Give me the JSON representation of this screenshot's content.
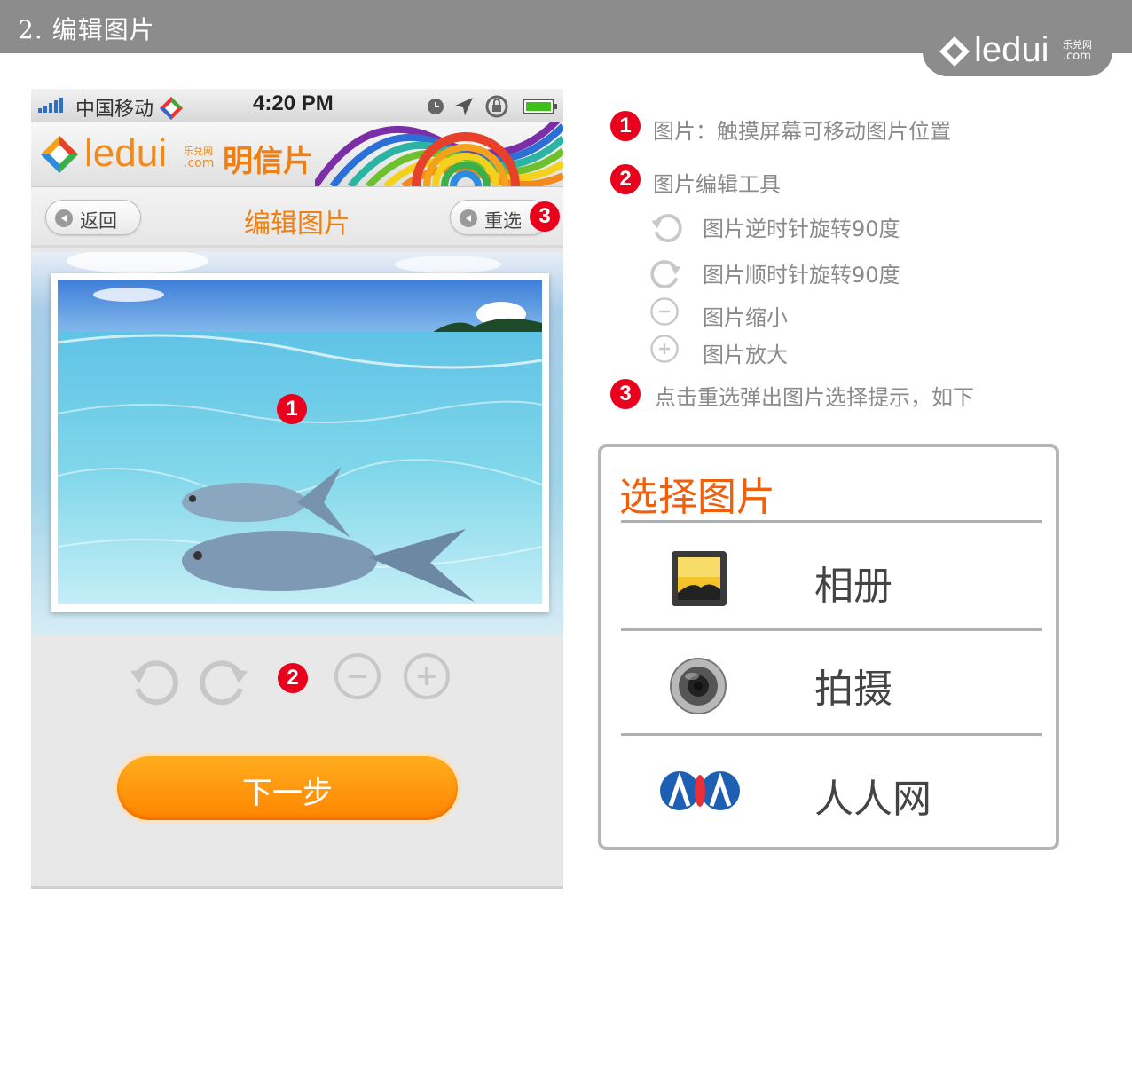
{
  "banner": {
    "title": "2. 编辑图片",
    "brand": "ledui",
    "brand_cn": "乐兑网",
    "brand_com": ".com"
  },
  "phone": {
    "status_bar": {
      "carrier": "中国移动",
      "time": "4:20 PM"
    },
    "app_header": {
      "brand": "ledui",
      "brand_cn": "乐兑网",
      "brand_com": ".com",
      "title": "明信片"
    },
    "nav": {
      "back_label": "返回",
      "title": "编辑图片",
      "reselect_label": "重选"
    },
    "next_button": "下一步"
  },
  "badges": {
    "one": "1",
    "two": "2",
    "three": "3"
  },
  "legend": {
    "item1": "图片：触摸屏幕可移动图片位置",
    "item2": "图片编辑工具",
    "tools": [
      {
        "icon": "rotate-ccw-icon",
        "label": "图片逆时针旋转90度"
      },
      {
        "icon": "rotate-cw-icon",
        "label": "图片顺时针旋转90度"
      },
      {
        "icon": "zoom-out-icon",
        "label": "图片缩小"
      },
      {
        "icon": "zoom-in-icon",
        "label": "图片放大"
      }
    ],
    "item3": "点击重选弹出图片选择提示，如下"
  },
  "dialog": {
    "title": "选择图片",
    "options": [
      {
        "icon": "album-icon",
        "label": "相册"
      },
      {
        "icon": "camera-icon",
        "label": "拍摄"
      },
      {
        "icon": "renren-icon",
        "label": "人人网"
      }
    ]
  },
  "colors": {
    "accent_orange": "#ee7f10",
    "badge_red": "#e8001c",
    "dialog_title": "#f0600c",
    "banner_gray": "#8c8c8c"
  }
}
